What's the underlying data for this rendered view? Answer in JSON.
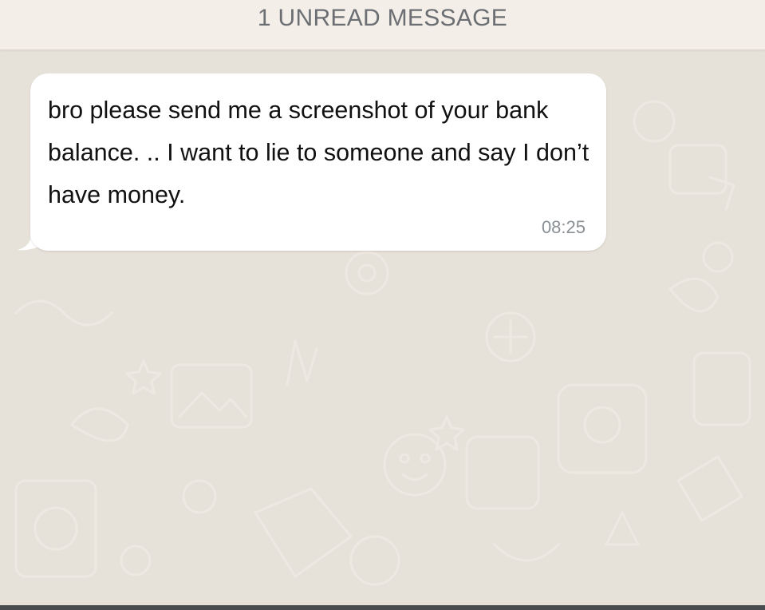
{
  "banner": {
    "text": "1 UNREAD MESSAGE"
  },
  "message": {
    "text": "bro please send me a screenshot of your bank balance. .. I want to lie to someone and say I don’t have money.",
    "time": "08:25"
  },
  "colors": {
    "bubble": "#ffffff",
    "background": "#e7e2d9",
    "banner": "#f3eee7",
    "timestamp": "#8a8f94"
  }
}
